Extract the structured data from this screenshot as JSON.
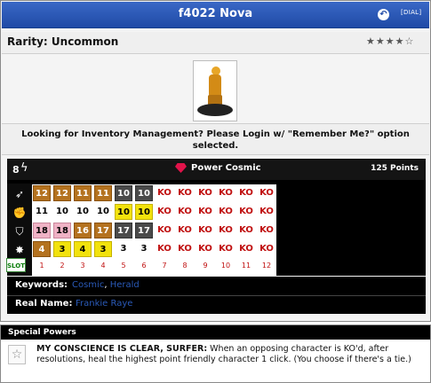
{
  "header": {
    "title": "f4022 Nova",
    "back_icon": "↶",
    "dial_label": "[DIAL]"
  },
  "rarity": {
    "label": "Rarity: Uncommon",
    "stars": "★★★★☆"
  },
  "login_message": "Looking for Inventory Management? Please Login w/ \"Remember Me?\" option selected.",
  "stats_bar": {
    "range": "8",
    "power": "Power Cosmic",
    "points": "125 Points"
  },
  "dial": {
    "rows": [
      [
        "12",
        "12",
        "11",
        "11",
        "10",
        "10",
        "KO",
        "KO",
        "KO",
        "KO",
        "KO",
        "KO"
      ],
      [
        "11",
        "10",
        "10",
        "10",
        "10",
        "10",
        "KO",
        "KO",
        "KO",
        "KO",
        "KO",
        "KO"
      ],
      [
        "18",
        "18",
        "16",
        "17",
        "17",
        "17",
        "KO",
        "KO",
        "KO",
        "KO",
        "KO",
        "KO"
      ],
      [
        "4",
        "3",
        "4",
        "3",
        "3",
        "3",
        "KO",
        "KO",
        "KO",
        "KO",
        "KO",
        "KO"
      ]
    ],
    "colors": [
      [
        "brown",
        "brown",
        "brown",
        "brown",
        "gray",
        "gray",
        "ko",
        "ko",
        "ko",
        "ko",
        "ko",
        "ko"
      ],
      [
        "plain",
        "plain",
        "plain",
        "plain",
        "yellow",
        "yellow",
        "ko",
        "ko",
        "ko",
        "ko",
        "ko",
        "ko"
      ],
      [
        "pink",
        "pink",
        "brown",
        "brown",
        "gray",
        "gray",
        "ko",
        "ko",
        "ko",
        "ko",
        "ko",
        "ko"
      ],
      [
        "brown",
        "yellow",
        "yellow",
        "yellow",
        "plain",
        "plain",
        "ko",
        "ko",
        "ko",
        "ko",
        "ko",
        "ko"
      ]
    ],
    "slot_label": "SLOT",
    "slots": [
      "1",
      "2",
      "3",
      "4",
      "5",
      "6",
      "7",
      "8",
      "9",
      "10",
      "11",
      "12"
    ],
    "stat_icons": [
      "speed-icon",
      "attack-icon",
      "defense-icon",
      "damage-icon"
    ]
  },
  "keywords": {
    "label": "Keywords:",
    "values": [
      "Cosmic",
      "Herald"
    ]
  },
  "real_name": {
    "label": "Real Name:",
    "value": "Frankie Raye"
  },
  "special_powers": {
    "header": "Special Powers",
    "items": [
      {
        "name": "MY CONSCIENCE IS CLEAR, SURFER:",
        "text": "When an opposing character is KO'd, after resolutions, heal the highest point friendly character 1 click. (You choose if there's a tie.)"
      }
    ]
  },
  "colors": {
    "title_blue": "#1f4aa6",
    "ko_red": "#c01010",
    "link_blue": "#2a5ab8"
  }
}
